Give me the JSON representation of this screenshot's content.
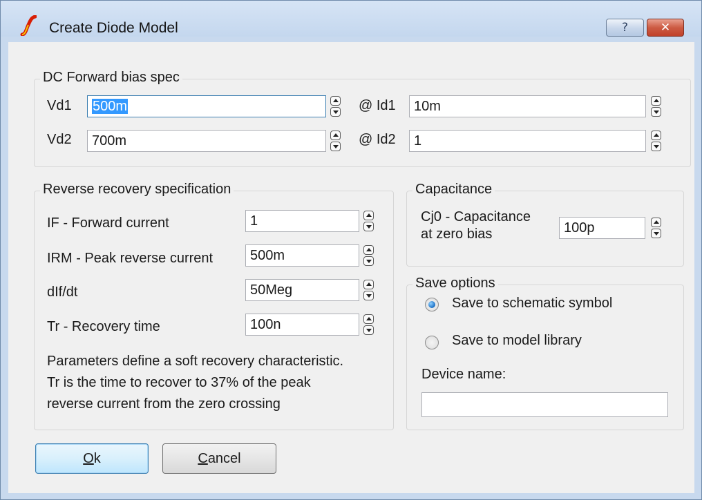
{
  "window": {
    "title": "Create Diode Model"
  },
  "caption_buttons": {
    "help": "?",
    "close": "✕"
  },
  "dc_forward": {
    "legend": "DC Forward bias spec",
    "vd1_label": "Vd1",
    "vd1_value": "500m",
    "id1_label": "@ Id1",
    "id1_value": "10m",
    "vd2_label": "Vd2",
    "vd2_value": "700m",
    "id2_label": "@ Id2",
    "id2_value": "1"
  },
  "reverse_recovery": {
    "legend": "Reverse recovery specification",
    "if_label": "IF - Forward current",
    "if_value": "1",
    "irm_label": "IRM - Peak reverse current",
    "irm_value": "500m",
    "didt_label": "dIf/dt",
    "didt_value": "50Meg",
    "tr_label": "Tr - Recovery time",
    "tr_value": "100n",
    "note_line1": "Parameters define a soft recovery characteristic.",
    "note_line2": "Tr is the time to recover to 37% of the peak",
    "note_line3": "reverse current from the zero crossing"
  },
  "capacitance": {
    "legend": "Capacitance",
    "cj0_label_line1": "Cj0 - Capacitance",
    "cj0_label_line2": "at zero bias",
    "cj0_value": "100p"
  },
  "save_options": {
    "legend": "Save options",
    "option_symbol": "Save to schematic symbol",
    "option_library": "Save to model library",
    "selected": "Save to schematic symbol",
    "device_name_label": "Device name:",
    "device_name_value": ""
  },
  "buttons": {
    "ok_mnemonic": "O",
    "ok_rest": "k",
    "cancel_mnemonic": "C",
    "cancel_rest": "ancel"
  },
  "colors": {
    "accent": "#3399ff",
    "titlebar": "#c8d9ee",
    "close": "#c0412a"
  }
}
